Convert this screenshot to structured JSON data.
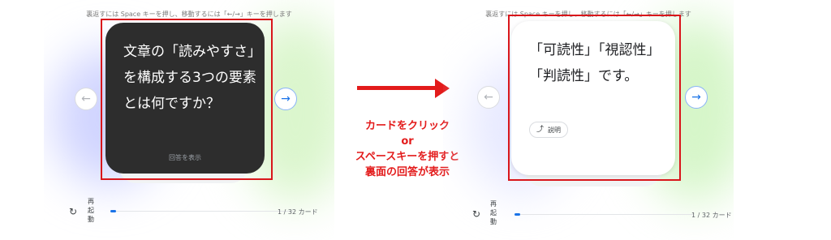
{
  "hint": "裏返すには Space キーを押し、移動するには「←/→」キーを押します",
  "nav": {
    "prev_icon": "←",
    "next_icon": "→"
  },
  "front": {
    "question": "文章の「読みやすさ」を構成する3つの要素とは何ですか？",
    "reveal_label": "回答を表示"
  },
  "back": {
    "answer": "「可読性」「視認性」「判読性」です。",
    "explain_label": "説明",
    "explain_icon": "⤴"
  },
  "footer": {
    "restart_icon": "↻",
    "restart_label": "再起動",
    "counter": "1 / 32 カード",
    "progress": 0.03
  },
  "annotation": {
    "line1": "カードをクリック",
    "line2": "or",
    "line3": "スペースキーを押すと",
    "line4": "裏面の回答が表示"
  },
  "colors": {
    "accent": "#1a73e8",
    "card_front": "#2d2d2d",
    "highlight": "#d9161b"
  }
}
